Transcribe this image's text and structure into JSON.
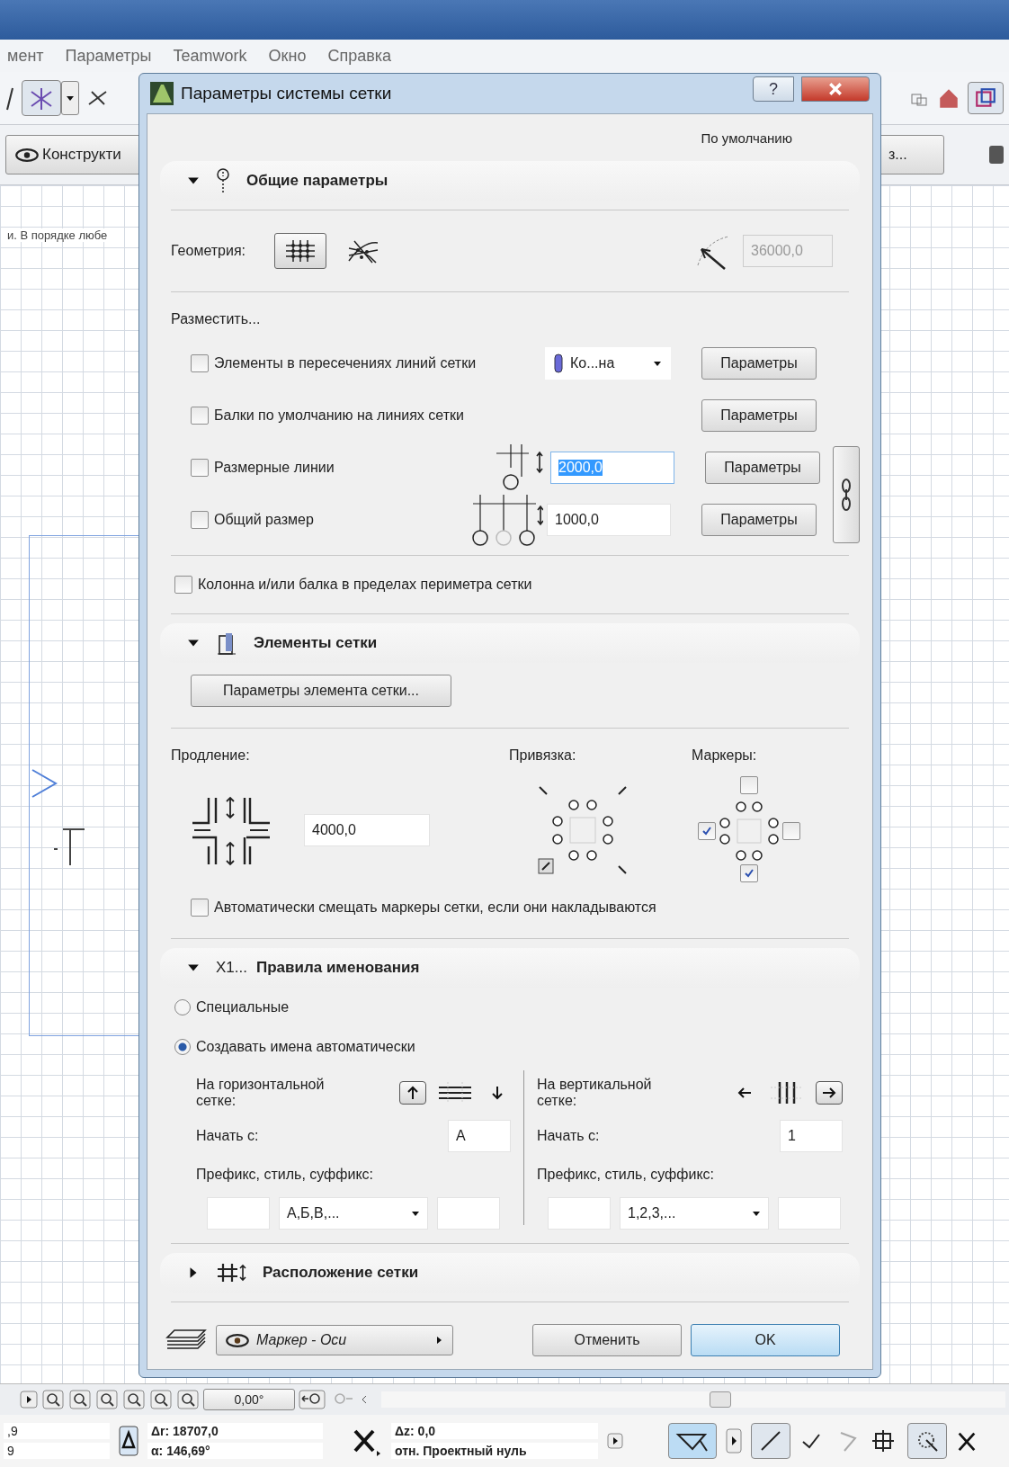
{
  "app": {
    "menu": [
      "мент",
      "Параметры",
      "Teamwork",
      "Окно",
      "Справка"
    ],
    "view_button": "Конструкти",
    "right_button": "з...",
    "canvas_text": "и. В порядке любе",
    "angle_field": "0,00°",
    "status": {
      "coord_1": ",9",
      "coord_2": "9",
      "delta_r": "Δr: 18707,0",
      "angle": "α: 146,69°",
      "delta_z": "Δz: 0,0",
      "reference": "отн. Проектный нуль"
    }
  },
  "dialog": {
    "title": "Параметры системы сетки",
    "help": "?",
    "preset": "По умолчанию",
    "general": {
      "title": "Общие параметры",
      "expanded": true,
      "geometry_label": "Геометрия:",
      "geometry_options": [
        {
          "kind": "orthogonal",
          "selected": true
        },
        {
          "kind": "radial",
          "selected": false
        }
      ],
      "angle_value": "36000,0",
      "angle_disabled": true,
      "place_label": "Разместить...",
      "place_rows": [
        {
          "kind": "element",
          "label": "Элементы в пересечениях линий сетки",
          "checked": false,
          "dropdown": "Ко...на",
          "button": "Параметры"
        },
        {
          "kind": "beam",
          "label": "Балки по умолчанию на линиях сетки",
          "checked": false,
          "button": "Параметры"
        },
        {
          "kind": "dimension",
          "label": "Размерные линии",
          "checked": false,
          "value": "2000,0",
          "value_selected": true,
          "button": "Параметры"
        },
        {
          "kind": "total_dimension",
          "label": "Общий размер",
          "checked": false,
          "value": "1000,0",
          "value_selected": false,
          "button": "Параметры"
        }
      ],
      "perimeter": {
        "label": "Колонна и/или балка в пределах периметра сетки",
        "checked": false
      }
    },
    "elements": {
      "title": "Элементы сетки",
      "expanded": true,
      "settings_button": "Параметры элемента сетки...",
      "extension_label": "Продление:",
      "extension_value": "4000,0",
      "snap_label": "Привязка:",
      "markers_label": "Маркеры:",
      "markers": [
        {
          "checked": false
        },
        {
          "checked": true
        },
        {
          "checked": false
        },
        {
          "checked": true
        }
      ],
      "auto_offset": {
        "label": "Автоматически смещать маркеры сетки, если они накладываются",
        "checked": false
      }
    },
    "naming": {
      "title_prefix": "X1...",
      "title": "Правила именования",
      "expanded": true,
      "modes": [
        {
          "label": "Специальные",
          "selected": false
        },
        {
          "label": "Создавать имена автоматически",
          "selected": true
        }
      ],
      "axes": [
        {
          "kind": "horizontal",
          "label": "На горизонтальной сетке:",
          "arrows": [
            {
              "selected": true
            },
            {
              "selected": false
            }
          ],
          "start_label": "Начать с:",
          "start": "А",
          "format_label": "Префикс, стиль, суффикс:",
          "style": "А,Б,В,..."
        },
        {
          "kind": "vertical",
          "label": "На вертикальной сетке:",
          "arrows": [
            {
              "selected": false
            },
            {
              "selected": true
            }
          ],
          "start_label": "Начать с:",
          "start": "1",
          "format_label": "Префикс, стиль, суффикс:",
          "style": "1,2,3,..."
        }
      ]
    },
    "layout": {
      "title": "Расположение сетки",
      "expanded": false
    },
    "footer": {
      "layer": "Маркер - Оси",
      "cancel": "Отменить",
      "ok": "OK"
    }
  }
}
